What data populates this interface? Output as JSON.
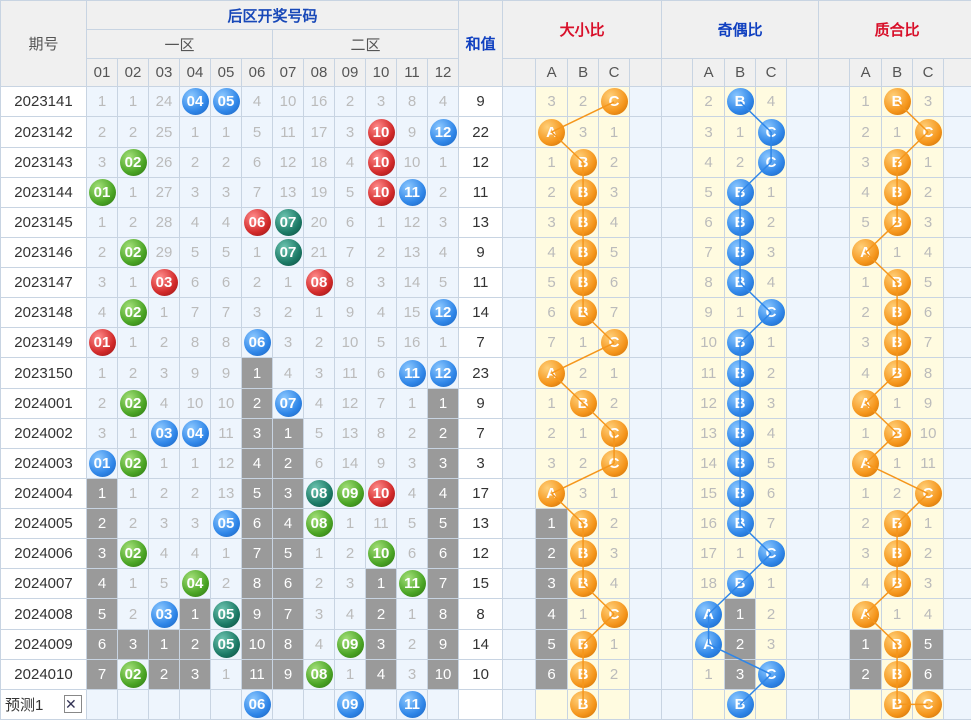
{
  "header": {
    "period": "期号",
    "title": "后区开奖号码",
    "zone1": "一区",
    "zone2": "二区",
    "sum": "和值",
    "big_small": "大小比",
    "odd_even": "奇偶比",
    "prime": "质合比",
    "abc": [
      "A",
      "B",
      "C"
    ]
  },
  "cols": [
    "01",
    "02",
    "03",
    "04",
    "05",
    "06",
    "07",
    "08",
    "09",
    "10",
    "11",
    "12"
  ],
  "rows": [
    {
      "p": "2023141",
      "cells": [
        "1",
        "1",
        "24",
        "04",
        "05",
        "4",
        "10",
        "16",
        "2",
        "3",
        "8",
        "4"
      ],
      "sum": "9",
      "bs": [
        "3",
        "2",
        "C"
      ],
      "oe": [
        "2",
        "B",
        "4"
      ],
      "pr": [
        "1",
        "B",
        "3"
      ]
    },
    {
      "p": "2023142",
      "cells": [
        "2",
        "2",
        "25",
        "1",
        "1",
        "5",
        "11",
        "17",
        "3",
        "10",
        "9",
        "12"
      ],
      "sum": "22",
      "bs": [
        "A",
        "3",
        "1"
      ],
      "oe": [
        "3",
        "1",
        "C"
      ],
      "pr": [
        "2",
        "1",
        "C"
      ]
    },
    {
      "p": "2023143",
      "cells": [
        "3",
        "02",
        "26",
        "2",
        "2",
        "6",
        "12",
        "18",
        "4",
        "10",
        "10",
        "1"
      ],
      "sum": "12",
      "bs": [
        "1",
        "B",
        "2"
      ],
      "oe": [
        "4",
        "2",
        "C"
      ],
      "pr": [
        "3",
        "B",
        "1"
      ]
    },
    {
      "p": "2023144",
      "cells": [
        "01",
        "1",
        "27",
        "3",
        "3",
        "7",
        "13",
        "19",
        "5",
        "10",
        "11",
        "2"
      ],
      "sum": "11",
      "bs": [
        "2",
        "B",
        "3"
      ],
      "oe": [
        "5",
        "B",
        "1"
      ],
      "pr": [
        "4",
        "B",
        "2"
      ]
    },
    {
      "p": "2023145",
      "cells": [
        "1",
        "2",
        "28",
        "4",
        "4",
        "06",
        "07",
        "20",
        "6",
        "1",
        "12",
        "3"
      ],
      "sum": "13",
      "bs": [
        "3",
        "B",
        "4"
      ],
      "oe": [
        "6",
        "B",
        "2"
      ],
      "pr": [
        "5",
        "B",
        "3"
      ]
    },
    {
      "p": "2023146",
      "cells": [
        "2",
        "02",
        "29",
        "5",
        "5",
        "1",
        "07",
        "21",
        "7",
        "2",
        "13",
        "4"
      ],
      "sum": "9",
      "bs": [
        "4",
        "B",
        "5"
      ],
      "oe": [
        "7",
        "B",
        "3"
      ],
      "pr": [
        "A",
        "1",
        "4"
      ]
    },
    {
      "p": "2023147",
      "cells": [
        "3",
        "1",
        "03",
        "6",
        "6",
        "2",
        "1",
        "08",
        "8",
        "3",
        "14",
        "5"
      ],
      "sum": "11",
      "bs": [
        "5",
        "B",
        "6"
      ],
      "oe": [
        "8",
        "B",
        "4"
      ],
      "pr": [
        "1",
        "B",
        "5"
      ]
    },
    {
      "p": "2023148",
      "cells": [
        "4",
        "02",
        "1",
        "7",
        "7",
        "3",
        "2",
        "1",
        "9",
        "4",
        "15",
        "12"
      ],
      "sum": "14",
      "bs": [
        "6",
        "B",
        "7"
      ],
      "oe": [
        "9",
        "1",
        "C"
      ],
      "pr": [
        "2",
        "B",
        "6"
      ]
    },
    {
      "p": "2023149",
      "cells": [
        "01",
        "1",
        "2",
        "8",
        "8",
        "06",
        "3",
        "2",
        "10",
        "5",
        "16",
        "1"
      ],
      "sum": "7",
      "bs": [
        "7",
        "1",
        "C"
      ],
      "oe": [
        "10",
        "B",
        "1"
      ],
      "pr": [
        "3",
        "B",
        "7"
      ]
    },
    {
      "p": "2023150",
      "cells": [
        "1",
        "2",
        "3",
        "9",
        "9",
        "1",
        "4",
        "3",
        "11",
        "6",
        "11",
        "12"
      ],
      "sum": "23",
      "bs": [
        "A",
        "2",
        "1"
      ],
      "oe": [
        "11",
        "B",
        "2"
      ],
      "pr": [
        "4",
        "B",
        "8"
      ]
    },
    {
      "p": "2024001",
      "cells": [
        "2",
        "02",
        "4",
        "10",
        "10",
        "2",
        "07",
        "4",
        "12",
        "7",
        "1",
        "1"
      ],
      "sum": "9",
      "bs": [
        "1",
        "B",
        "2"
      ],
      "oe": [
        "12",
        "B",
        "3"
      ],
      "pr": [
        "A",
        "1",
        "9"
      ]
    },
    {
      "p": "2024002",
      "cells": [
        "3",
        "1",
        "03",
        "04",
        "11",
        "3",
        "1",
        "5",
        "13",
        "8",
        "2",
        "2"
      ],
      "sum": "7",
      "bs": [
        "2",
        "1",
        "C"
      ],
      "oe": [
        "13",
        "B",
        "4"
      ],
      "pr": [
        "1",
        "B",
        "10"
      ]
    },
    {
      "p": "2024003",
      "cells": [
        "01",
        "02",
        "1",
        "1",
        "12",
        "4",
        "2",
        "6",
        "14",
        "9",
        "3",
        "3"
      ],
      "sum": "3",
      "bs": [
        "3",
        "2",
        "C"
      ],
      "oe": [
        "14",
        "B",
        "5"
      ],
      "pr": [
        "A",
        "1",
        "11"
      ]
    },
    {
      "p": "2024004",
      "cells": [
        "1",
        "1",
        "2",
        "2",
        "13",
        "5",
        "3",
        "08",
        "09",
        "10",
        "4",
        "4"
      ],
      "sum": "17",
      "bs": [
        "A",
        "3",
        "1"
      ],
      "oe": [
        "15",
        "B",
        "6"
      ],
      "pr": [
        "1",
        "2",
        "C"
      ]
    },
    {
      "p": "2024005",
      "cells": [
        "2",
        "2",
        "3",
        "3",
        "05",
        "6",
        "4",
        "08",
        "1",
        "11",
        "5",
        "5"
      ],
      "sum": "13",
      "bs": [
        "1",
        "B",
        "2"
      ],
      "oe": [
        "16",
        "B",
        "7"
      ],
      "pr": [
        "2",
        "B",
        "1"
      ]
    },
    {
      "p": "2024006",
      "cells": [
        "3",
        "02",
        "4",
        "4",
        "1",
        "7",
        "5",
        "1",
        "2",
        "10",
        "6",
        "6"
      ],
      "sum": "12",
      "bs": [
        "2",
        "B",
        "3"
      ],
      "oe": [
        "17",
        "1",
        "C"
      ],
      "pr": [
        "3",
        "B",
        "2"
      ]
    },
    {
      "p": "2024007",
      "cells": [
        "4",
        "1",
        "5",
        "04",
        "2",
        "8",
        "6",
        "2",
        "3",
        "1",
        "11",
        "7"
      ],
      "sum": "15",
      "bs": [
        "3",
        "B",
        "4"
      ],
      "oe": [
        "18",
        "B",
        "1"
      ],
      "pr": [
        "4",
        "B",
        "3"
      ]
    },
    {
      "p": "2024008",
      "cells": [
        "5",
        "2",
        "03",
        "1",
        "05",
        "9",
        "7",
        "3",
        "4",
        "2",
        "1",
        "8"
      ],
      "sum": "8",
      "bs": [
        "4",
        "1",
        "C"
      ],
      "oe": [
        "A",
        "1",
        "2"
      ],
      "pr": [
        "A",
        "1",
        "4"
      ]
    },
    {
      "p": "2024009",
      "cells": [
        "6",
        "3",
        "1",
        "2",
        "05",
        "10",
        "8",
        "4",
        "09",
        "3",
        "2",
        "9"
      ],
      "sum": "14",
      "bs": [
        "5",
        "B",
        "1"
      ],
      "oe": [
        "A",
        "2",
        "3"
      ],
      "pr": [
        "1",
        "B",
        "5"
      ]
    },
    {
      "p": "2024010",
      "cells": [
        "7",
        "02",
        "2",
        "3",
        "1",
        "11",
        "9",
        "08",
        "1",
        "4",
        "3",
        "10"
      ],
      "sum": "10",
      "bs": [
        "6",
        "B",
        "2"
      ],
      "oe": [
        "1",
        "3",
        "C"
      ],
      "pr": [
        "2",
        "B",
        "6"
      ]
    }
  ],
  "predict": {
    "label": "预测1",
    "close": "✕",
    "cells": [
      "",
      "",
      "",
      "",
      "",
      "06",
      "",
      "",
      "09",
      "",
      "11",
      ""
    ],
    "bs": [
      "",
      "B",
      ""
    ],
    "oe": [
      "",
      "B",
      ""
    ],
    "pr": [
      "",
      "B",
      "C"
    ]
  },
  "colors": {
    "blue": "#2f86e8",
    "red": "#d22a2a",
    "green": "#4aa424",
    "teal": "#1c7a66",
    "orange": "#f5961c",
    "gray": "#9a9a9a"
  }
}
